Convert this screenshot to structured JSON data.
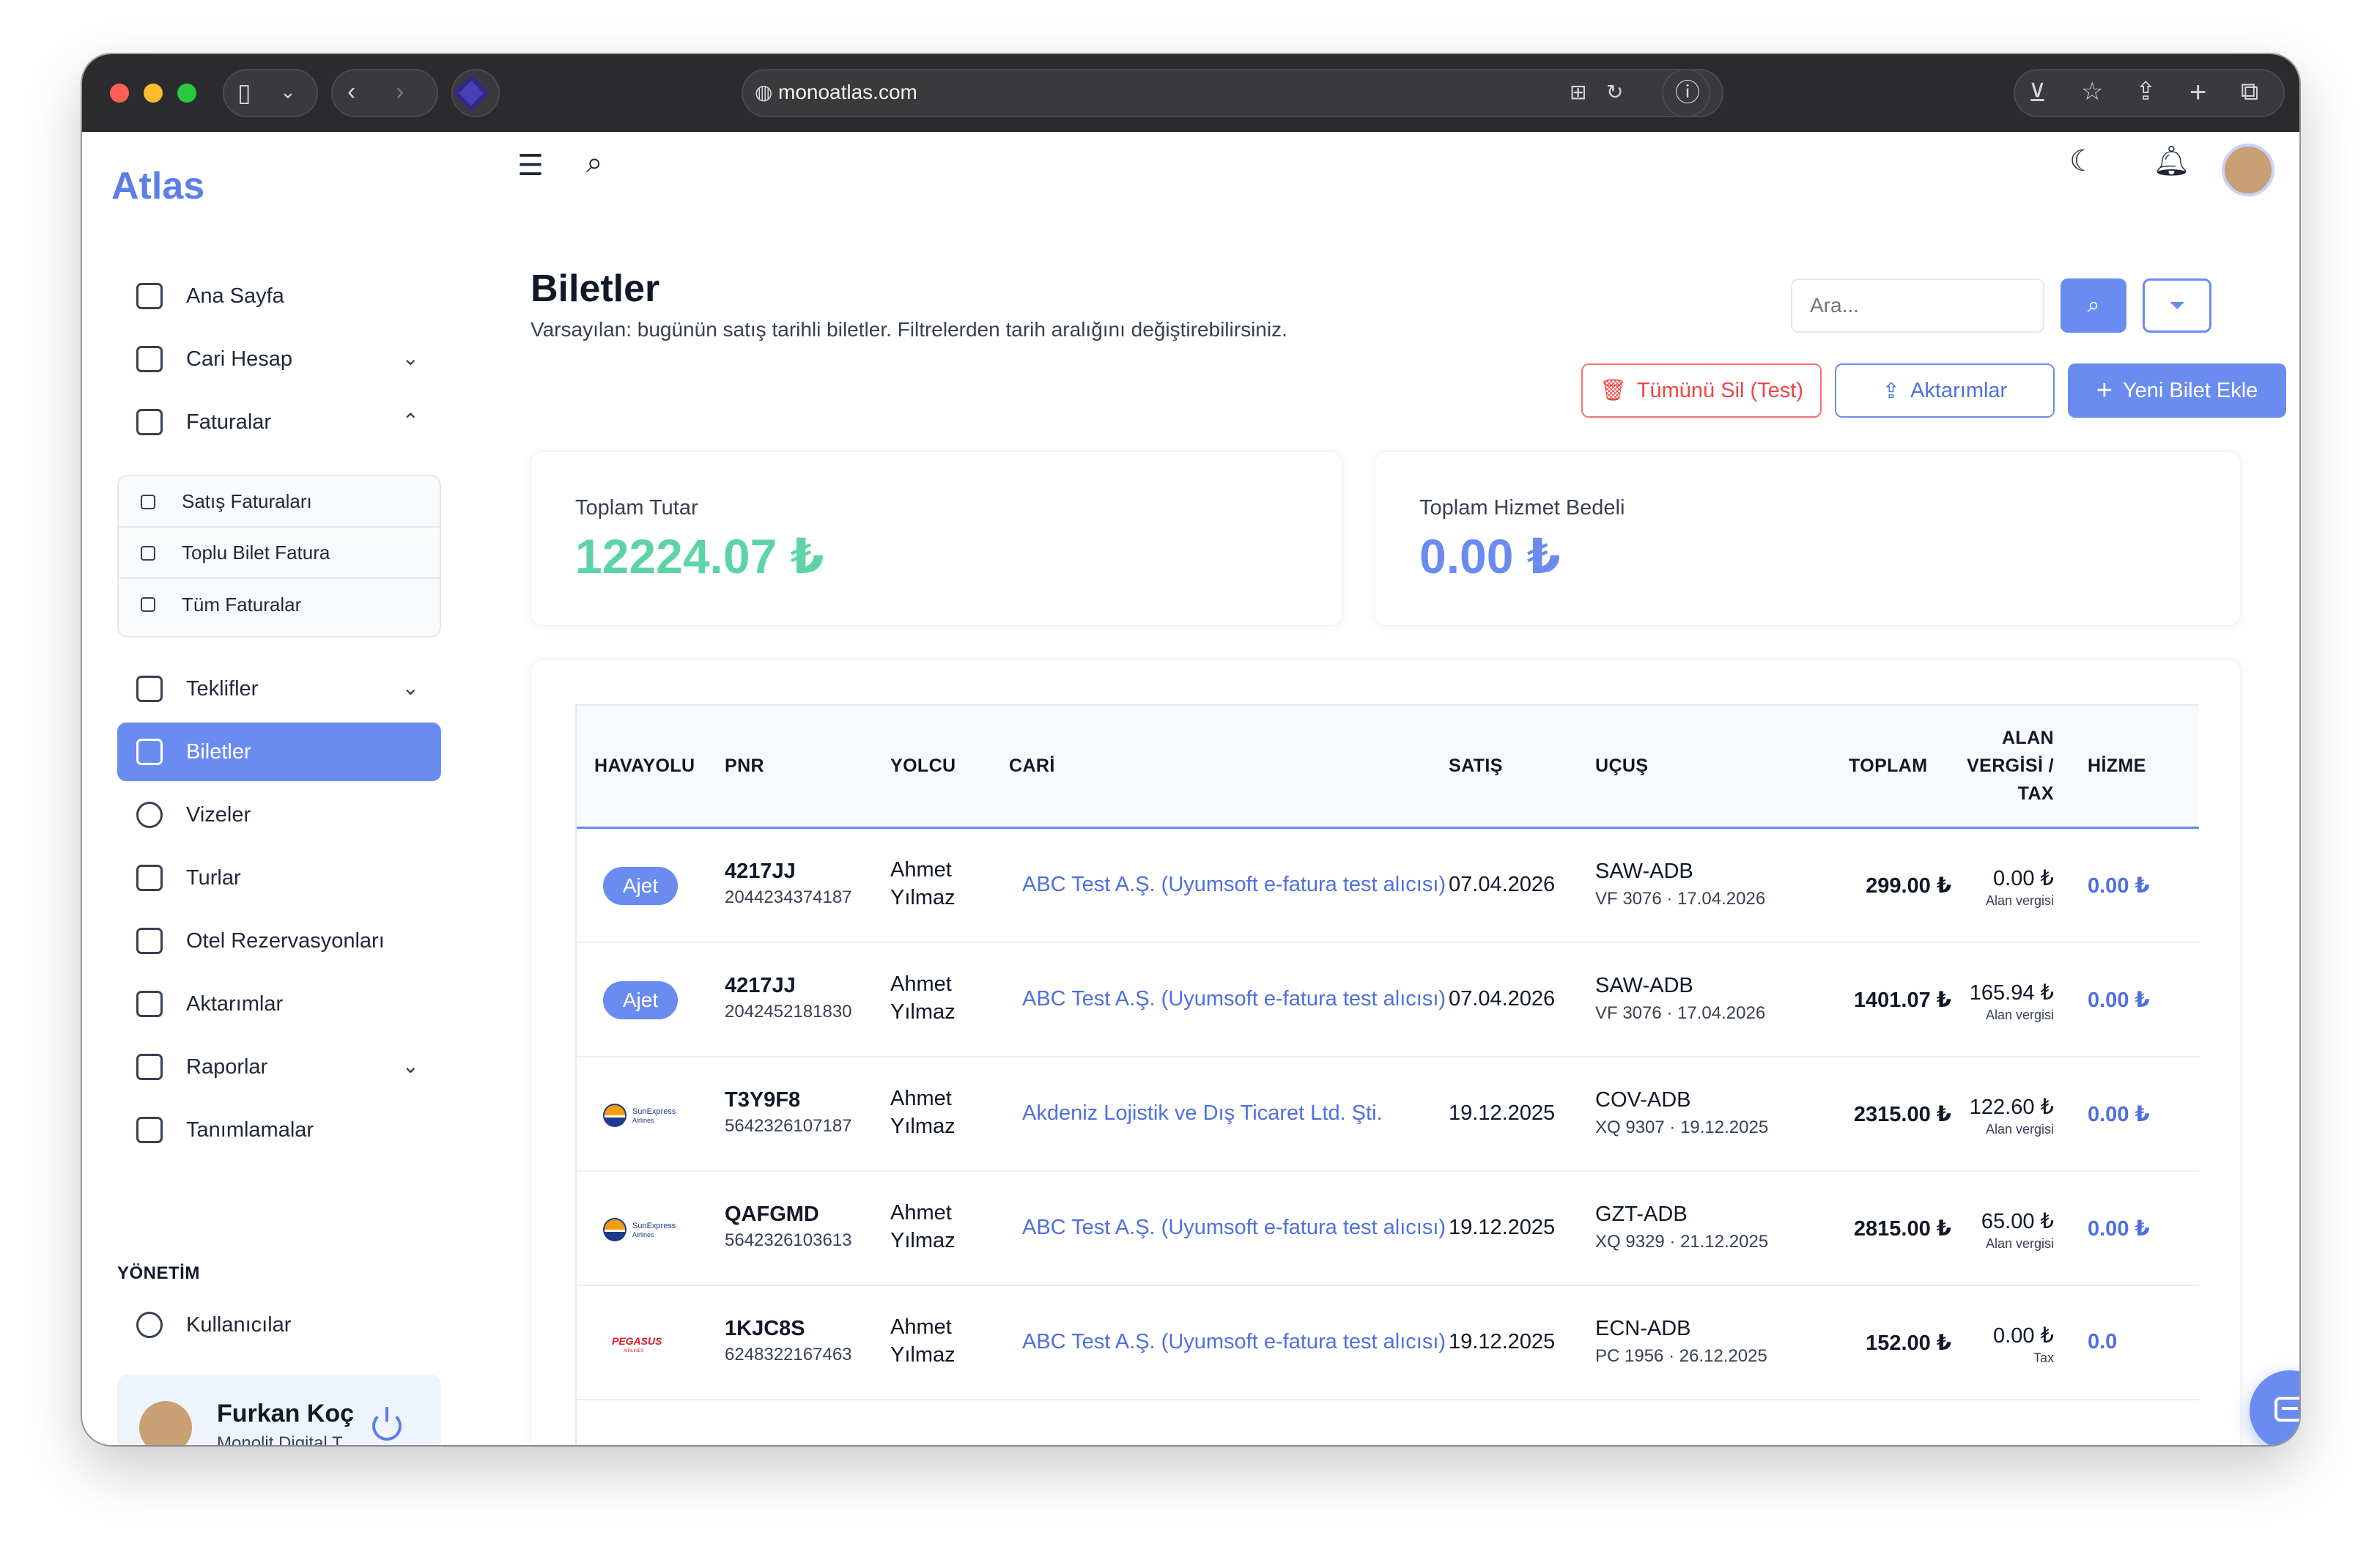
{
  "browser": {
    "url": "monoatlas.com"
  },
  "sidebar": {
    "logo": "Atlas",
    "items": [
      {
        "label": "Ana Sayfa",
        "icon": "grid-icon"
      },
      {
        "label": "Cari Hesap",
        "icon": "wallet-icon",
        "chevron": "down"
      },
      {
        "label": "Faturalar",
        "icon": "document-icon",
        "chevron": "up"
      },
      {
        "label": "Teklifler",
        "icon": "dollar-document-icon",
        "chevron": "down"
      },
      {
        "label": "Biletler",
        "icon": "ticket-icon",
        "active": true
      },
      {
        "label": "Vizeler",
        "icon": "globe-icon"
      },
      {
        "label": "Turlar",
        "icon": "route-icon"
      },
      {
        "label": "Otel Rezervasyonları",
        "icon": "building-icon"
      },
      {
        "label": "Aktarımlar",
        "icon": "upload-icon"
      },
      {
        "label": "Raporlar",
        "icon": "clipboard-icon",
        "chevron": "down"
      },
      {
        "label": "Tanımlamalar",
        "icon": "file-settings-icon"
      }
    ],
    "submenu": [
      {
        "label": "Satış Faturaları"
      },
      {
        "label": "Toplu Bilet Fatura"
      },
      {
        "label": "Tüm Faturalar"
      }
    ],
    "section_label": "YÖNETİM",
    "admin_items": [
      {
        "label": "Kullanıcılar",
        "icon": "user-settings-icon"
      }
    ],
    "user": {
      "name": "Furkan Koç",
      "org": "Monolit Digital T..."
    }
  },
  "page": {
    "title": "Biletler",
    "subtitle": "Varsayılan: bugünün satış tarihli biletler. Filtrelerden tarih aralığını değiştirebilirsiniz.",
    "search_placeholder": "Ara...",
    "buttons": {
      "delete_all": "Tümünü Sil (Test)",
      "transfers": "Aktarımlar",
      "add_ticket": "Yeni Bilet Ekle"
    }
  },
  "stats": {
    "total_amount_label": "Toplam Tutar",
    "total_amount_value": "12224.07 ₺",
    "total_service_label": "Toplam Hizmet Bedeli",
    "total_service_value": "0.00 ₺"
  },
  "table": {
    "headers": {
      "havayolu": "HAVAYOLU",
      "pnr": "PNR",
      "yolcu": "YOLCU",
      "cari": "CARİ",
      "satis": "SATIŞ",
      "ucus": "UÇUŞ",
      "toplam": "TOPLAM",
      "alan_1": "ALAN",
      "alan_2": "VERGİSİ /",
      "alan_3": "TAX",
      "hizmet": "HİZME"
    },
    "rows": [
      {
        "airline": "Ajet",
        "pnr": "4217JJ",
        "ticket_no": "2044234374187",
        "pax_first": "Ahmet",
        "pax_last": "Yılmaz",
        "cari": "ABC Test A.Ş. (Uyumsoft e-fatura test alıcısı)",
        "sale_date": "07.04.2026",
        "route": "SAW-ADB",
        "flight": "VF 3076 · 17.04.2026",
        "total": "299.00 ₺",
        "tax": "0.00 ₺",
        "tax_label": "Alan vergisi",
        "service": "0.00 ₺"
      },
      {
        "airline": "Ajet",
        "pnr": "4217JJ",
        "ticket_no": "2042452181830",
        "pax_first": "Ahmet",
        "pax_last": "Yılmaz",
        "cari": "ABC Test A.Ş. (Uyumsoft e-fatura test alıcısı)",
        "sale_date": "07.04.2026",
        "route": "SAW-ADB",
        "flight": "VF 3076 · 17.04.2026",
        "total": "1401.07 ₺",
        "tax": "165.94 ₺",
        "tax_label": "Alan vergisi",
        "service": "0.00 ₺"
      },
      {
        "airline": "SunExpress",
        "airline_sub": "Airlines",
        "pnr": "T3Y9F8",
        "ticket_no": "5642326107187",
        "pax_first": "Ahmet",
        "pax_last": "Yılmaz",
        "cari": "Akdeniz Lojistik ve Dış Ticaret Ltd. Şti.",
        "sale_date": "19.12.2025",
        "route": "COV-ADB",
        "flight": "XQ 9307 · 19.12.2025",
        "total": "2315.00 ₺",
        "tax": "122.60 ₺",
        "tax_label": "Alan vergisi",
        "service": "0.00 ₺"
      },
      {
        "airline": "SunExpress",
        "airline_sub": "Airlines",
        "pnr": "QAFGMD",
        "ticket_no": "5642326103613",
        "pax_first": "Ahmet",
        "pax_last": "Yılmaz",
        "cari": "ABC Test A.Ş. (Uyumsoft e-fatura test alıcısı)",
        "sale_date": "19.12.2025",
        "route": "GZT-ADB",
        "flight": "XQ 9329 · 21.12.2025",
        "total": "2815.00 ₺",
        "tax": "65.00 ₺",
        "tax_label": "Alan vergisi",
        "service": "0.00 ₺"
      },
      {
        "airline": "PEGASUS",
        "airline_sub": "AIRLINES",
        "pnr": "1KJC8S",
        "ticket_no": "6248322167463",
        "pax_first": "Ahmet",
        "pax_last": "Yılmaz",
        "cari": "ABC Test A.Ş. (Uyumsoft e-fatura test alıcısı)",
        "sale_date": "19.12.2025",
        "route": "ECN-ADB",
        "flight": "PC 1956 · 26.12.2025",
        "total": "152.00 ₺",
        "tax": "0.00 ₺",
        "tax_label": "Tax",
        "service": "0.0"
      }
    ]
  },
  "colors": {
    "accent": "#6a8cf0",
    "link": "#4f6fe0",
    "green_total": "#5fd3a8",
    "danger": "#ef4444"
  }
}
